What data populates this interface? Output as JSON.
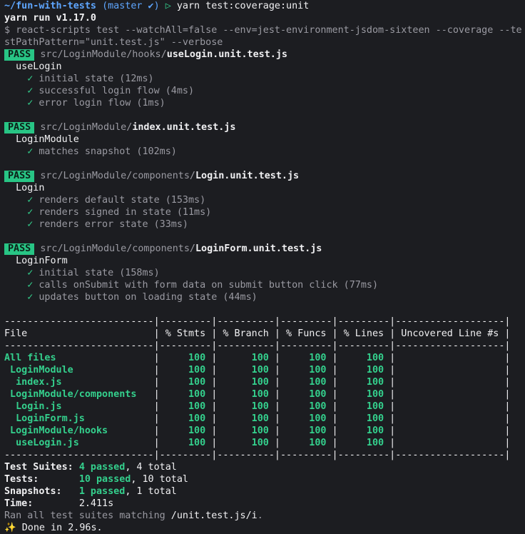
{
  "prompt": {
    "path": "~/fun-with-tests",
    "branch": "(master ✔)",
    "arrow": "▷",
    "command": "yarn test:coverage:unit"
  },
  "yarn_version": "yarn run v1.17.0",
  "cmd_line_1": "$ react-scripts test --watchAll=false --env=jest-environment-jsdom-sixteen --coverage --te",
  "cmd_line_2": "stPathPattern=\"unit.test.js\" --verbose",
  "suites": [
    {
      "badge": "PASS",
      "dir": "src/LoginModule/hooks/",
      "file": "useLogin.unit.test.js",
      "describe": "useLogin",
      "tests": [
        "initial state (12ms)",
        "successful login flow (4ms)",
        "error login flow (1ms)"
      ]
    },
    {
      "badge": "PASS",
      "dir": "src/LoginModule/",
      "file": "index.unit.test.js",
      "describe": "LoginModule",
      "tests": [
        "matches snapshot (102ms)"
      ]
    },
    {
      "badge": "PASS",
      "dir": "src/LoginModule/components/",
      "file": "Login.unit.test.js",
      "describe": "Login",
      "tests": [
        "renders default state (153ms)",
        "renders signed in state (11ms)",
        "renders error state (33ms)"
      ]
    },
    {
      "badge": "PASS",
      "dir": "src/LoginModule/components/",
      "file": "LoginForm.unit.test.js",
      "describe": "LoginForm",
      "tests": [
        "initial state (158ms)",
        "calls onSubmit with form data on submit button click (77ms)",
        "updates button on loading state (44ms)"
      ]
    }
  ],
  "check": "✓",
  "coverage": {
    "border_top": "--------------------------|---------|----------|---------|---------|-------------------|",
    "header": [
      "File",
      "% Stmts",
      "% Branch",
      "% Funcs",
      "% Lines",
      "Uncovered Line #s"
    ],
    "rows": [
      {
        "name": "All files",
        "indent": 0,
        "stmts": "100",
        "branch": "100",
        "funcs": "100",
        "lines": "100",
        "uncovered": ""
      },
      {
        "name": "LoginModule",
        "indent": 1,
        "stmts": "100",
        "branch": "100",
        "funcs": "100",
        "lines": "100",
        "uncovered": ""
      },
      {
        "name": "index.js",
        "indent": 2,
        "stmts": "100",
        "branch": "100",
        "funcs": "100",
        "lines": "100",
        "uncovered": ""
      },
      {
        "name": "LoginModule/components",
        "indent": 1,
        "stmts": "100",
        "branch": "100",
        "funcs": "100",
        "lines": "100",
        "uncovered": ""
      },
      {
        "name": "Login.js",
        "indent": 2,
        "stmts": "100",
        "branch": "100",
        "funcs": "100",
        "lines": "100",
        "uncovered": ""
      },
      {
        "name": "LoginForm.js",
        "indent": 2,
        "stmts": "100",
        "branch": "100",
        "funcs": "100",
        "lines": "100",
        "uncovered": ""
      },
      {
        "name": "LoginModule/hooks",
        "indent": 1,
        "stmts": "100",
        "branch": "100",
        "funcs": "100",
        "lines": "100",
        "uncovered": ""
      },
      {
        "name": "useLogin.js",
        "indent": 2,
        "stmts": "100",
        "branch": "100",
        "funcs": "100",
        "lines": "100",
        "uncovered": ""
      }
    ]
  },
  "summary": {
    "suites_label": "Test Suites:",
    "suites_pass": "4 passed",
    "suites_total": ", 4 total",
    "tests_label": "Tests:",
    "tests_pass": "10 passed",
    "tests_total": ", 10 total",
    "snap_label": "Snapshots:",
    "snap_pass": "1 passed",
    "snap_total": ", 1 total",
    "time_label": "Time:",
    "time_value": "2.411s",
    "ran_prefix": "Ran all test suites matching ",
    "ran_pattern": "/unit.test.js/i",
    "ran_suffix": ".",
    "done_icon": "✨",
    "done_text": " Done in 2.96s."
  },
  "colors": {
    "green": "#34d08d",
    "blue": "#5ea6ff",
    "pass_bg": "#28c585",
    "bg": "#1c1d21"
  }
}
